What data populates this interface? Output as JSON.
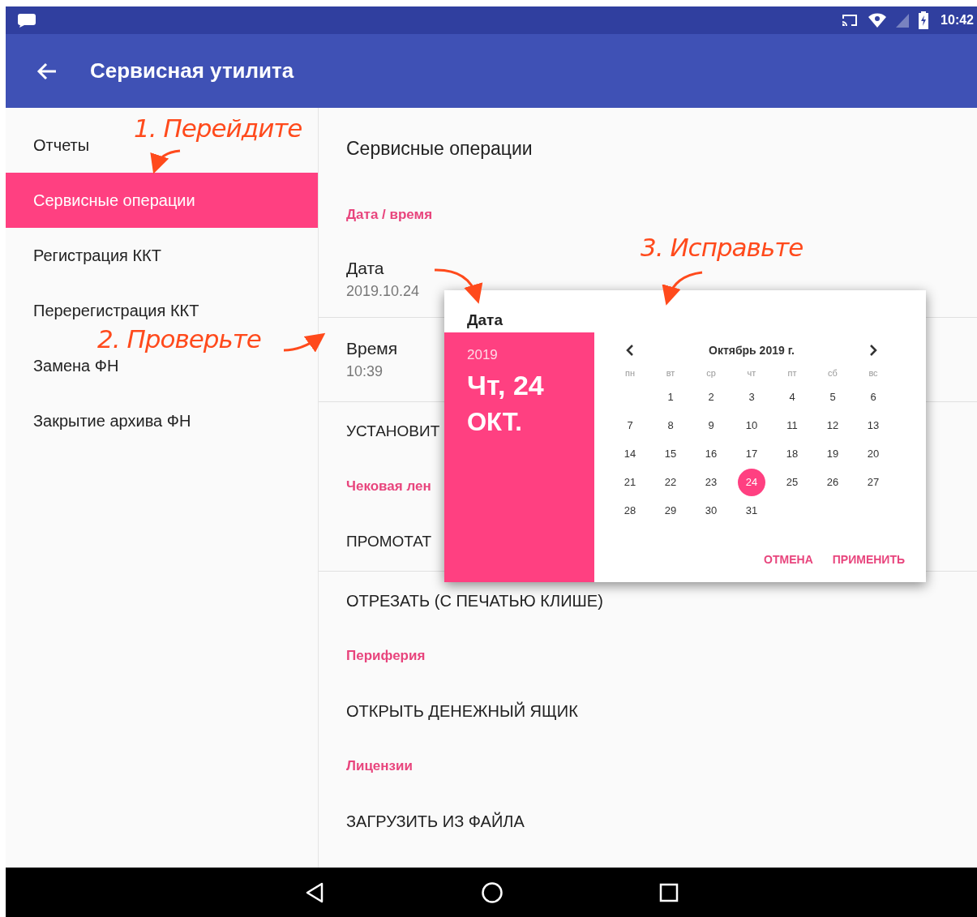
{
  "status_bar": {
    "time": "10:42"
  },
  "app_bar": {
    "title": "Сервисная утилита"
  },
  "sidebar": {
    "items": [
      {
        "label": "Отчеты",
        "selected": false
      },
      {
        "label": "Сервисные операции",
        "selected": true
      },
      {
        "label": "Регистрация ККТ",
        "selected": false
      },
      {
        "label": "Перерегистрация ККТ",
        "selected": false
      },
      {
        "label": "Замена ФН",
        "selected": false
      },
      {
        "label": "Закрытие архива ФН",
        "selected": false
      }
    ]
  },
  "content": {
    "title": "Сервисные операции",
    "items": [
      {
        "kind": "header",
        "label": "Дата / время"
      },
      {
        "kind": "setting",
        "label": "Дата",
        "value": "2019.10.24",
        "divider_after": true
      },
      {
        "kind": "setting",
        "label": "Время",
        "value": "10:39",
        "divider_after": true
      },
      {
        "kind": "action",
        "label": "УСТАНОВИТ"
      },
      {
        "kind": "header",
        "label": "Чековая лен"
      },
      {
        "kind": "action",
        "label": "ПРОМОТАТ",
        "divider_after": true
      },
      {
        "kind": "action",
        "label": "ОТРЕЗАТЬ (С ПЕЧАТЬЮ КЛИШЕ)"
      },
      {
        "kind": "header",
        "label": "Периферия"
      },
      {
        "kind": "action",
        "label": "ОТКРЫТЬ ДЕНЕЖНЫЙ ЯЩИК"
      },
      {
        "kind": "header",
        "label": "Лицензии"
      },
      {
        "kind": "action",
        "label": "ЗАГРУЗИТЬ ИЗ ФАЙЛА"
      }
    ]
  },
  "dialog": {
    "title": "Дата",
    "year": "2019",
    "date_line": "Чт, 24",
    "month_line": "ОКТ.",
    "calendar": {
      "month": "Октябрь 2019 г.",
      "weekdays": [
        "пн",
        "вт",
        "ср",
        "чт",
        "пт",
        "сб",
        "вс"
      ],
      "weeks": [
        {
          "kind": "first",
          "days": [
            {
              "day": "1",
              "selected": false
            },
            {
              "day": "2",
              "selected": false
            },
            {
              "day": "3",
              "selected": false
            },
            {
              "day": "4",
              "selected": false
            },
            {
              "day": "5",
              "selected": false
            },
            {
              "day": "6",
              "selected": false
            }
          ]
        },
        {
          "kind": "full",
          "days": [
            {
              "day": "7",
              "selected": false
            },
            {
              "day": "8",
              "selected": false
            },
            {
              "day": "9",
              "selected": false
            },
            {
              "day": "10",
              "selected": false
            },
            {
              "day": "11",
              "selected": false
            },
            {
              "day": "12",
              "selected": false
            },
            {
              "day": "13",
              "selected": false
            }
          ]
        },
        {
          "kind": "full",
          "days": [
            {
              "day": "14",
              "selected": false
            },
            {
              "day": "15",
              "selected": false
            },
            {
              "day": "16",
              "selected": false
            },
            {
              "day": "17",
              "selected": false
            },
            {
              "day": "18",
              "selected": false
            },
            {
              "day": "19",
              "selected": false
            },
            {
              "day": "20",
              "selected": false
            }
          ]
        },
        {
          "kind": "full",
          "days": [
            {
              "day": "21",
              "selected": false
            },
            {
              "day": "22",
              "selected": false
            },
            {
              "day": "23",
              "selected": false
            },
            {
              "day": "24",
              "selected": true
            },
            {
              "day": "25",
              "selected": false
            },
            {
              "day": "26",
              "selected": false
            },
            {
              "day": "27",
              "selected": false
            }
          ]
        },
        {
          "kind": "last",
          "days": [
            {
              "day": "28",
              "selected": false
            },
            {
              "day": "29",
              "selected": false
            },
            {
              "day": "30",
              "selected": false
            },
            {
              "day": "31",
              "selected": false
            }
          ]
        }
      ]
    },
    "buttons": [
      "ОТМЕНА",
      "ПРИМЕНИТЬ"
    ]
  },
  "annotations": [
    {
      "text": "1. Перейдите"
    },
    {
      "text": "2. Проверьте"
    },
    {
      "text": "3. Исправьте"
    }
  ]
}
